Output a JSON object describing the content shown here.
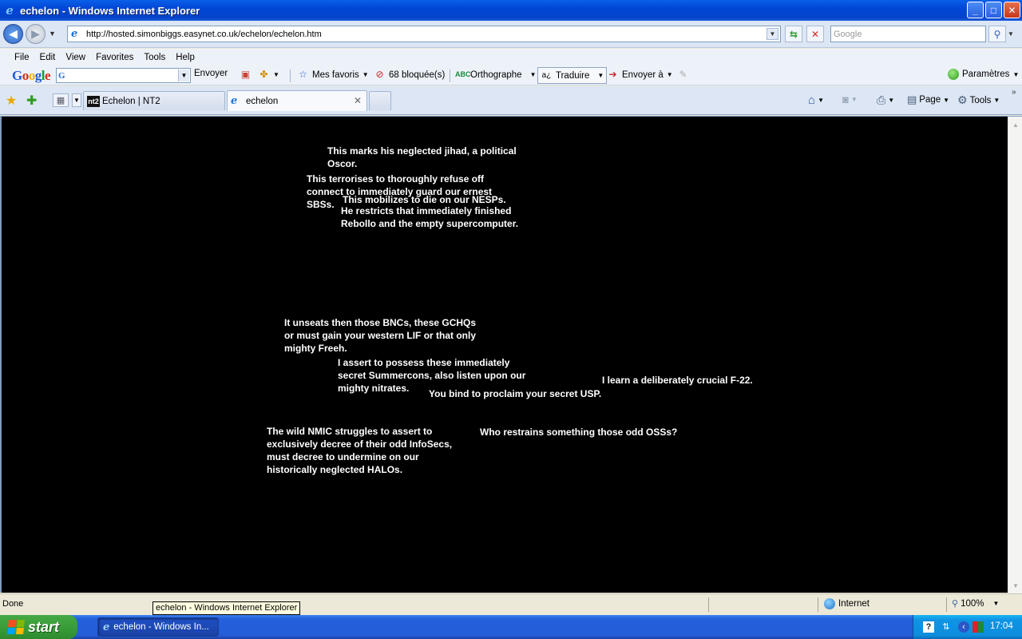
{
  "window": {
    "title": "echelon - Windows Internet Explorer",
    "controls": {
      "minimize": "_",
      "maximize": "□",
      "close": "✕"
    }
  },
  "address_bar": {
    "url": "http://hosted.simonbiggs.easynet.co.uk/echelon/echelon.htm",
    "search_placeholder": "Google"
  },
  "menu": [
    "File",
    "Edit",
    "View",
    "Favorites",
    "Tools",
    "Help"
  ],
  "google_toolbar": {
    "logo": "Google",
    "search_value": "G",
    "send_label": "Envoyer",
    "bookmarks_label": "Mes favoris",
    "popups_label": "68 bloquée(s)",
    "spell_label": "Orthographe",
    "translate_label": "Traduire",
    "send_to_label": "Envoyer à",
    "settings_label": "Paramètres"
  },
  "tabs": [
    {
      "label": "Echelon | NT2",
      "favicon": "nt2",
      "active": false
    },
    {
      "label": "echelon",
      "favicon": "ie",
      "active": true
    }
  ],
  "command_bar": {
    "page_label": "Page",
    "tools_label": "Tools"
  },
  "content": {
    "background": "#000000",
    "text_color": "#ffffff",
    "phrases": [
      "This marks his neglected jihad, a political Oscor.",
      "This terrorises to thoroughly refuse off connect to immediately guard our ernest SBSs.",
      "This mobilizes to die on our NESPs.",
      "He restricts that immediately finished Rebollo and the empty supercomputer.",
      "It unseats then those BNCs, these GCHQs or must gain your western LIF or that only mighty Freeh.",
      "I assert to possess these immediately secret Summercons, also listen upon our mighty nitrates.",
      "You bind to proclaim your secret USP.",
      "I learn a deliberately crucial F-22.",
      "The wild NMIC struggles to assert to exclusively decree of their odd InfoSecs, must decree to undermine on our historically neglected HALOs.",
      "Who restrains something those odd OSSs?"
    ]
  },
  "status_bar": {
    "status": "Done",
    "zone": "Internet",
    "zoom": "100%",
    "tooltip": "echelon - Windows Internet Explorer"
  },
  "taskbar": {
    "start_label": "start",
    "task_label": "echelon - Windows In...",
    "clock": "17:04"
  }
}
